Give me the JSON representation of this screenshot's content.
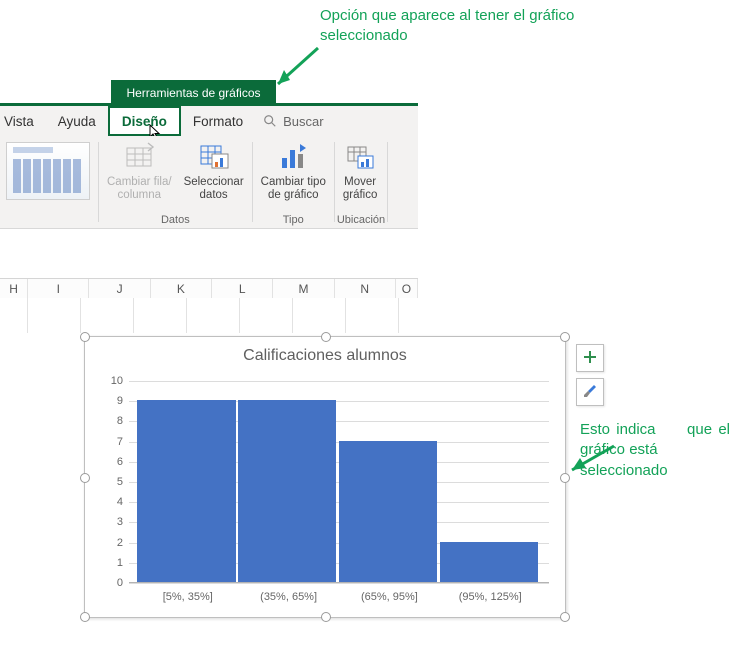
{
  "annotations": {
    "top": "Opción que aparece al tener el gráfico seleccionado",
    "right_l1": "Esto indica",
    "right_l2": "que el gráfico",
    "right_l3": "está",
    "right_l4": "seleccionado"
  },
  "contextual_tab_title": "Herramientas de gráficos",
  "tabs": {
    "vista": "Vista",
    "ayuda": "Ayuda",
    "diseno": "Diseño",
    "formato": "Formato",
    "search_placeholder": "Buscar"
  },
  "ribbon": {
    "cambiar_fila_l1": "Cambiar fila/",
    "cambiar_fila_l2": "columna",
    "seleccionar_l1": "Seleccionar",
    "seleccionar_l2": "datos",
    "cambiar_tipo_l1": "Cambiar tipo",
    "cambiar_tipo_l2": "de gráfico",
    "mover_l1": "Mover",
    "mover_l2": "gráfico",
    "group_datos": "Datos",
    "group_tipo": "Tipo",
    "group_ubicacion": "Ubicación"
  },
  "columns": {
    "h": "H",
    "i": "I",
    "j": "J",
    "k": "K",
    "l": "L",
    "m": "M",
    "n": "N",
    "o": "O"
  },
  "chart_data": {
    "type": "bar",
    "title": "Calificaciones alumnos",
    "categories": [
      "[5%, 35%]",
      "(35%, 65%]",
      "(65%, 95%]",
      "(95%, 125%]"
    ],
    "values": [
      9,
      9,
      7,
      2
    ],
    "xlabel": "",
    "ylabel": "",
    "ylim": [
      0,
      10
    ],
    "yticks": [
      0,
      1,
      2,
      3,
      4,
      5,
      6,
      7,
      8,
      9,
      10
    ]
  }
}
